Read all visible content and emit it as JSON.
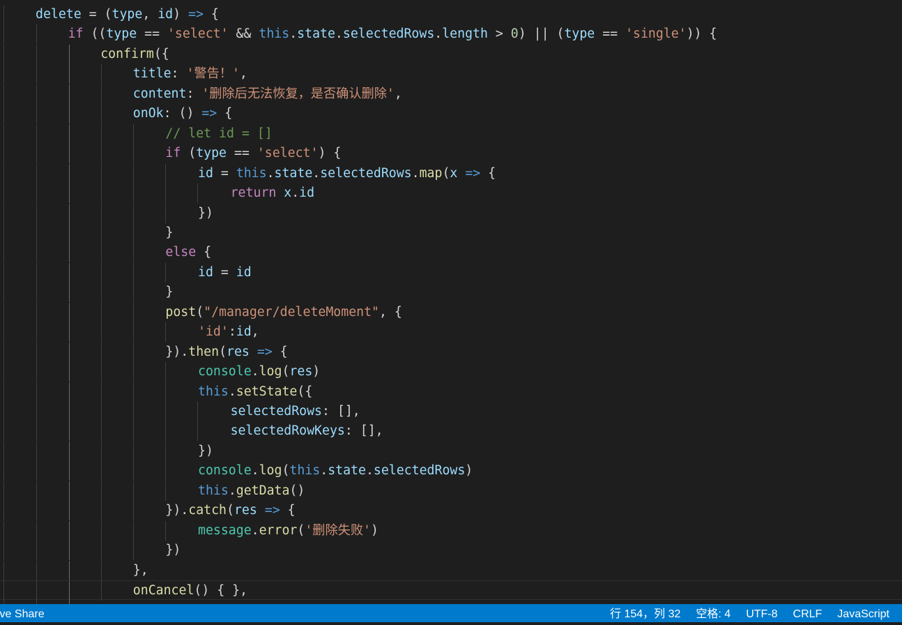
{
  "code_lines": [
    "delete = (type, id) => {",
    "if ((type == 'select' && this.state.selectedRows.length > 0) || (type == 'single')) {",
    "confirm({",
    "title: '警告！',",
    "content: '删除后无法恢复，是否确认删除',",
    "onOk: () => {",
    "// let id = []",
    "if (type == 'select') {",
    "id = this.state.selectedRows.map(x => {",
    "return x.id",
    "})",
    "}",
    "else {",
    "id = id",
    "}",
    "post(\"/manager/deleteMoment\", {",
    "'id':id,",
    "}).then(res => {",
    "console.log(res)",
    "this.setState({",
    "selectedRows: [],",
    "selectedRowKeys: [],",
    "})",
    "console.log(this.state.selectedRows)",
    "this.getData()",
    "}).catch(res => {",
    "message.error('删除失败')",
    "})",
    "},",
    "onCancel() { },"
  ],
  "status_bar": {
    "live_share": "ive Share",
    "position": "行 154，列 32",
    "indent": "空格: 4",
    "encoding": "UTF-8",
    "eol": "CRLF",
    "language": "JavaScript"
  },
  "colors": {
    "editor_bg": "#1e1e1e",
    "status_bg": "#007acc"
  }
}
